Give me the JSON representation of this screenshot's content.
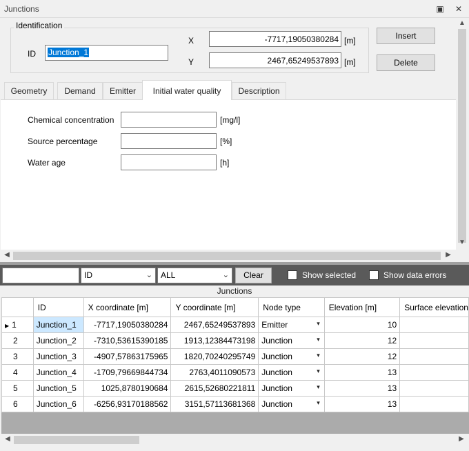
{
  "window": {
    "title": "Junctions",
    "restore_symbol": "▣",
    "close_symbol": "✕"
  },
  "identification": {
    "legend": "Identification",
    "id_label": "ID",
    "id_value": "Junction_1",
    "x_label": "X",
    "x_value": "-7717,19050380284",
    "x_unit": "[m]",
    "y_label": "Y",
    "y_value": "2467,65249537893",
    "y_unit": "[m]",
    "insert_label": "Insert",
    "delete_label": "Delete"
  },
  "tabs": [
    "Geometry",
    "Demand",
    "Emitter",
    "Initial water quality",
    "Description"
  ],
  "active_tab": "Initial water quality",
  "water_quality": {
    "chem_label": "Chemical concentration",
    "chem_unit": "[mg/l]",
    "chem_value": "",
    "source_label": "Source percentage",
    "source_unit": "[%]",
    "source_value": "",
    "age_label": "Water age",
    "age_unit": "[h]",
    "age_value": ""
  },
  "filter": {
    "search_value": "",
    "field_value": "ID",
    "scope_value": "ALL",
    "clear_label": "Clear",
    "show_selected_label": "Show selected",
    "show_errors_label": "Show data errors"
  },
  "grid": {
    "caption": "Junctions",
    "columns": [
      "",
      "ID",
      "X coordinate [m]",
      "Y coordinate [m]",
      "Node type",
      "Elevation [m]",
      "Surface elevation"
    ],
    "rows": [
      {
        "n": "1",
        "id": "Junction_1",
        "x": "-7717,19050380284",
        "y": "2467,65249537893",
        "type": "Emitter",
        "elev": "10",
        "current": true
      },
      {
        "n": "2",
        "id": "Junction_2",
        "x": "-7310,53615390185",
        "y": "1913,12384473198",
        "type": "Junction",
        "elev": "12"
      },
      {
        "n": "3",
        "id": "Junction_3",
        "x": "-4907,57863175965",
        "y": "1820,70240295749",
        "type": "Junction",
        "elev": "12"
      },
      {
        "n": "4",
        "id": "Junction_4",
        "x": "-1709,79669844734",
        "y": "2763,4011090573",
        "type": "Junction",
        "elev": "13"
      },
      {
        "n": "5",
        "id": "Junction_5",
        "x": "1025,8780190684",
        "y": "2615,52680221811",
        "type": "Junction",
        "elev": "13"
      },
      {
        "n": "6",
        "id": "Junction_6",
        "x": "-6256,93170188562",
        "y": "3151,57113681368",
        "type": "Junction",
        "elev": "13"
      }
    ]
  },
  "icons": {
    "restore": "restore-icon",
    "close": "close-icon",
    "scroll_up": "▲",
    "scroll_down": "▼",
    "scroll_left": "◀",
    "scroll_right": "▶",
    "dropdown": "▾",
    "row_indicator": "▶"
  },
  "colors": {
    "selection": "#cce8ff",
    "filter_bar": "#5a5a5a",
    "id_highlight": "#0078d7"
  }
}
